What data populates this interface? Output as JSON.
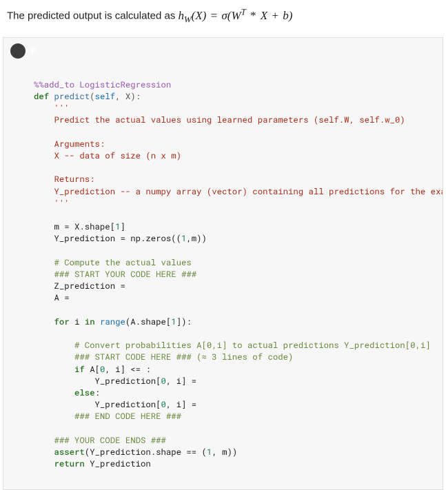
{
  "description": {
    "prefix": "The predicted output is calculated as ",
    "formula_html": "<span class='math'>h<sub>W</sub>(X) <span class='op'>=</span> σ(W<sup>T</sup> <span class='op'>*</span> X <span class='op'>+</span> b)</span>"
  },
  "code_cell": {
    "run_button_aria": "Run cell",
    "lines": [
      {
        "parts": [
          {
            "t": "%%add_to LogisticRegression",
            "c": "tok-magic"
          }
        ]
      },
      {
        "parts": [
          {
            "t": "def ",
            "c": "tok-kw"
          },
          {
            "t": "predict",
            "c": "tok-func"
          },
          {
            "t": "(",
            "c": "tok-op"
          },
          {
            "t": "self",
            "c": "tok-builtin"
          },
          {
            "t": ", X):",
            "c": "tok-op"
          }
        ]
      },
      {
        "parts": [
          {
            "t": "    '''",
            "c": "tok-str"
          }
        ]
      },
      {
        "parts": [
          {
            "t": "    Predict the actual values using learned parameters (self.W, self.w_0)",
            "c": "tok-str"
          }
        ]
      },
      {
        "parts": [
          {
            "t": " ",
            "c": ""
          }
        ]
      },
      {
        "parts": [
          {
            "t": "    Arguments:",
            "c": "tok-str"
          }
        ]
      },
      {
        "parts": [
          {
            "t": "    X -- data of size (n x m)",
            "c": "tok-str"
          }
        ]
      },
      {
        "parts": [
          {
            "t": " ",
            "c": ""
          }
        ]
      },
      {
        "parts": [
          {
            "t": "    Returns:",
            "c": "tok-str"
          }
        ]
      },
      {
        "parts": [
          {
            "t": "    Y_prediction -- a numpy array (vector) containing all predictions for the examples in X",
            "c": "tok-str"
          }
        ]
      },
      {
        "parts": [
          {
            "t": "    '''",
            "c": "tok-str"
          }
        ]
      },
      {
        "parts": [
          {
            "t": " ",
            "c": ""
          }
        ]
      },
      {
        "parts": [
          {
            "t": "    m = X.shape[",
            "c": "tok-name"
          },
          {
            "t": "1",
            "c": "tok-num"
          },
          {
            "t": "]",
            "c": "tok-name"
          }
        ]
      },
      {
        "parts": [
          {
            "t": "    Y_prediction = np.zeros((",
            "c": "tok-name"
          },
          {
            "t": "1",
            "c": "tok-num"
          },
          {
            "t": ",m))",
            "c": "tok-name"
          }
        ]
      },
      {
        "parts": [
          {
            "t": " ",
            "c": ""
          }
        ]
      },
      {
        "parts": [
          {
            "t": "    # Compute the actual values",
            "c": "tok-comm"
          }
        ]
      },
      {
        "parts": [
          {
            "t": "    ### START YOUR CODE HERE ###",
            "c": "tok-comm"
          }
        ]
      },
      {
        "parts": [
          {
            "t": "    Z_prediction = ",
            "c": "tok-name"
          }
        ]
      },
      {
        "parts": [
          {
            "t": "    A = ",
            "c": "tok-name"
          }
        ]
      },
      {
        "parts": [
          {
            "t": " ",
            "c": ""
          }
        ]
      },
      {
        "parts": [
          {
            "t": "    ",
            "c": ""
          },
          {
            "t": "for ",
            "c": "tok-kw"
          },
          {
            "t": "i ",
            "c": "tok-name"
          },
          {
            "t": "in ",
            "c": "tok-kw"
          },
          {
            "t": "range",
            "c": "tok-builtin"
          },
          {
            "t": "(A.shape[",
            "c": "tok-name"
          },
          {
            "t": "1",
            "c": "tok-num"
          },
          {
            "t": "]):",
            "c": "tok-name"
          }
        ]
      },
      {
        "parts": [
          {
            "t": " ",
            "c": ""
          }
        ]
      },
      {
        "parts": [
          {
            "t": "        # Convert probabilities A[0,i] to actual predictions Y_prediction[0,i]",
            "c": "tok-comm"
          }
        ]
      },
      {
        "parts": [
          {
            "t": "        ### START CODE HERE ### (≈ 3 lines of code)",
            "c": "tok-comm"
          }
        ]
      },
      {
        "parts": [
          {
            "t": "        ",
            "c": ""
          },
          {
            "t": "if ",
            "c": "tok-kw"
          },
          {
            "t": "A[",
            "c": "tok-name"
          },
          {
            "t": "0",
            "c": "tok-num"
          },
          {
            "t": ", i] <= :",
            "c": "tok-name"
          }
        ]
      },
      {
        "parts": [
          {
            "t": "            Y_prediction[",
            "c": "tok-name"
          },
          {
            "t": "0",
            "c": "tok-num"
          },
          {
            "t": ", i] = ",
            "c": "tok-name"
          }
        ]
      },
      {
        "parts": [
          {
            "t": "        ",
            "c": ""
          },
          {
            "t": "else",
            "c": "tok-kw"
          },
          {
            "t": ":",
            "c": "tok-name"
          }
        ]
      },
      {
        "parts": [
          {
            "t": "            Y_prediction[",
            "c": "tok-name"
          },
          {
            "t": "0",
            "c": "tok-num"
          },
          {
            "t": ", i] = ",
            "c": "tok-name"
          }
        ]
      },
      {
        "parts": [
          {
            "t": "        ### END CODE HERE ###",
            "c": "tok-comm"
          }
        ]
      },
      {
        "parts": [
          {
            "t": " ",
            "c": ""
          }
        ]
      },
      {
        "parts": [
          {
            "t": "    ### YOUR CODE ENDS ###",
            "c": "tok-comm"
          }
        ]
      },
      {
        "parts": [
          {
            "t": "    ",
            "c": ""
          },
          {
            "t": "assert",
            "c": "tok-kw"
          },
          {
            "t": "(Y_prediction.shape == (",
            "c": "tok-name"
          },
          {
            "t": "1",
            "c": "tok-num"
          },
          {
            "t": ", m))",
            "c": "tok-name"
          }
        ]
      },
      {
        "parts": [
          {
            "t": "    ",
            "c": ""
          },
          {
            "t": "return ",
            "c": "tok-kw"
          },
          {
            "t": "Y_prediction",
            "c": "tok-name"
          }
        ]
      }
    ]
  }
}
